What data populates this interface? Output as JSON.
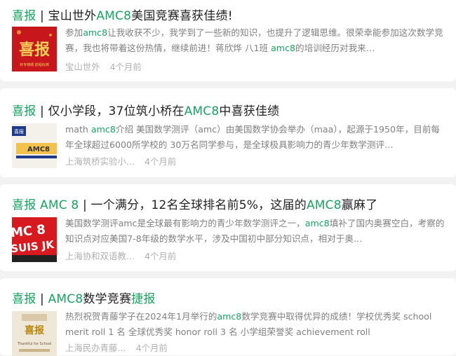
{
  "results": [
    {
      "title_parts": [
        {
          "text": "喜报",
          "hl": true
        },
        {
          "text": " | 宝山世外",
          "hl": false
        },
        {
          "text": "AMC8",
          "hl": true
        },
        {
          "text": "美国竞赛喜获佳绩!",
          "hl": false
        }
      ],
      "thumb_text": "喜报",
      "thumb_caption": "好专锦绣  前程似锦",
      "snippet_parts": [
        {
          "text": "参加",
          "kw": false
        },
        {
          "text": "amc8",
          "kw": true
        },
        {
          "text": "让我收获不少，我学到了一些新的知识，也提升了逻辑思维。很荣幸能参加这次数学竞赛，我也将带着这份热情，继续前进！蒋欣烨 八1班 ",
          "kw": false
        },
        {
          "text": "amc8",
          "kw": true
        },
        {
          "text": "的培训经历对我来…",
          "kw": false
        }
      ],
      "source": "宝山世外",
      "time": "4个月前"
    },
    {
      "title_parts": [
        {
          "text": "喜报",
          "hl": true
        },
        {
          "text": " | 仅小学段，37位筑小桥在",
          "hl": false
        },
        {
          "text": "AMC8",
          "hl": true
        },
        {
          "text": "中喜获佳绩",
          "hl": false
        }
      ],
      "thumb_text": "AMC8",
      "thumb_badge": "喜报",
      "snippet_parts": [
        {
          "text": "math ",
          "kw": false
        },
        {
          "text": "amc8",
          "kw": true
        },
        {
          "text": "介绍 美国数学测评（amc）由美国数学协会举办（maa），起源于1950年，目前每年全球超过6000所学校的 30万名同学参与，是全球极具影响力的青少年数学测评…",
          "kw": false
        }
      ],
      "source": "上海筑桥实验小…",
      "time": "4个月前"
    },
    {
      "title_parts": [
        {
          "text": "喜报 AMC 8",
          "hl": true
        },
        {
          "text": " | 一个满分，12名全球排名前5%，这届的",
          "hl": false
        },
        {
          "text": "AMC8",
          "hl": true
        },
        {
          "text": "赢麻了",
          "hl": false
        }
      ],
      "thumb_text": "MC 8",
      "thumb_text2": "SUIS JK",
      "snippet_parts": [
        {
          "text": "美国数学测评amc是全球最有影响力的青少年数学测评之一，",
          "kw": false
        },
        {
          "text": "amc8",
          "kw": true
        },
        {
          "text": "填补了国内奥赛空白，考察的知识点对应美国7-8年级的数学水平，涉及中国初中部分知识点，相对于奥…",
          "kw": false
        }
      ],
      "source": "上海协和双语教…",
      "time": "4个月前"
    },
    {
      "title_parts": [
        {
          "text": "喜报",
          "hl": true
        },
        {
          "text": " | ",
          "hl": false
        },
        {
          "text": "AMC8",
          "hl": true
        },
        {
          "text": "数学竞赛",
          "hl": false
        },
        {
          "text": "捷报",
          "hl": true
        }
      ],
      "thumb_text": "喜报",
      "thumb_caption": "Thankful for School",
      "snippet_parts": [
        {
          "text": "热烈祝贺青藤学子在2024年1月举行的",
          "kw": false
        },
        {
          "text": "amc8",
          "kw": true
        },
        {
          "text": "数学竞赛中取得优异的成绩！学校优秀奖 school merit roll 1 名 全球优秀奖 honor roll 3 名 小学组荣誉奖 achievement roll",
          "kw": false
        }
      ],
      "source": "上海民办青藤…",
      "time": "4个月前"
    }
  ]
}
